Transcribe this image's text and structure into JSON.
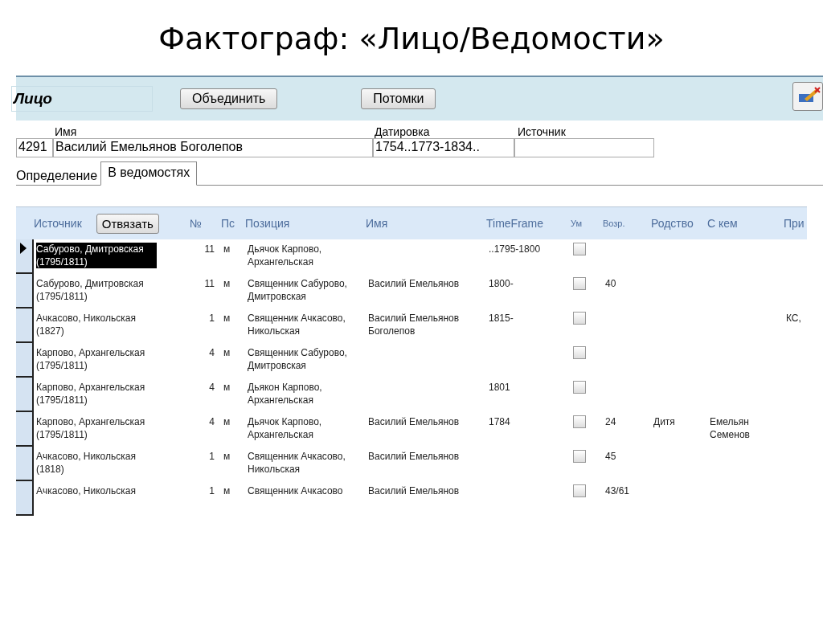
{
  "slide_title": "Фактограф: «Лицо/Ведомости»",
  "form": {
    "title": "Лицо",
    "buttons": [
      "Объединить",
      "Потомки"
    ],
    "fields": {
      "name_label": "Имя",
      "dating_label": "Датировка",
      "source_label": "Источник",
      "id": "4291",
      "name": "Василий Емельянов Боголепов",
      "dating": "1754..1773-1834.."
    }
  },
  "tabs": [
    {
      "label": "Определение",
      "selected": false
    },
    {
      "label": "В ведомостях",
      "selected": true
    }
  ],
  "table": {
    "columns": [
      "Источник",
      "№",
      "Пс",
      "Позиция",
      "Имя",
      "TimeFrame",
      "Ум",
      "Возр.",
      "Родство",
      "С кем",
      "При"
    ],
    "unbind_button": "Отвязать",
    "rows": [
      {
        "selected": true,
        "source": "Сабурово, Дмитровская (1795/1811)",
        "number": "11",
        "gender": "м",
        "position": "Дьячок Карпово, Архангельская",
        "timeframe": "..1795-1800",
        "dead": false
      },
      {
        "selected": false,
        "source": "Сабурово, Дмитровская (1795/1811)",
        "number": "11",
        "gender": "м",
        "position": "Священник Сабурово, Дмитровская",
        "name": "Василий Емельянов",
        "timeframe": "1800-",
        "dead": false,
        "age": "40"
      },
      {
        "selected": false,
        "source": "Ачкасово, Никольская (1827)",
        "number": "1",
        "gender": "м",
        "position": "Священник Ачкасово, Никольская",
        "name": "Василий Емельянов Боголепов",
        "timeframe": "1815-",
        "dead": false,
        "column_12": "КС,"
      },
      {
        "selected": false,
        "source": "Карпово, Архангельская (1795/1811)",
        "number": "4",
        "gender": "м",
        "position": "Священник Сабурово, Дмитровская",
        "dead": false
      },
      {
        "selected": false,
        "source": "Карпово, Архангельская (1795/1811)",
        "number": "4",
        "gender": "м",
        "position": "Дьякон Карпово, Архангельская",
        "timeframe": "1801",
        "dead": false
      },
      {
        "selected": false,
        "source": "Карпово, Архангельская (1795/1811)",
        "number": "4",
        "gender": "м",
        "position": "Дьячок Карпово, Архангельская",
        "name": "Василий Емельянов",
        "timeframe": "1784",
        "dead": false,
        "age": "24",
        "relation": "Дитя",
        "with_whom": "Емельян Семенов"
      },
      {
        "selected": false,
        "source": "Ачкасово, Никольская (1818)",
        "number": "1",
        "gender": "м",
        "position": "Священник Ачкасово, Никольская",
        "name": "Василий Емельянов",
        "dead": false,
        "age": "45"
      },
      {
        "selected": false,
        "source": "Ачкасово, Никольская",
        "number": "1",
        "gender": "м",
        "position": "Священник Ачкасово",
        "name": "Василий Емельянов",
        "dead": false,
        "age": "43/61"
      }
    ]
  }
}
